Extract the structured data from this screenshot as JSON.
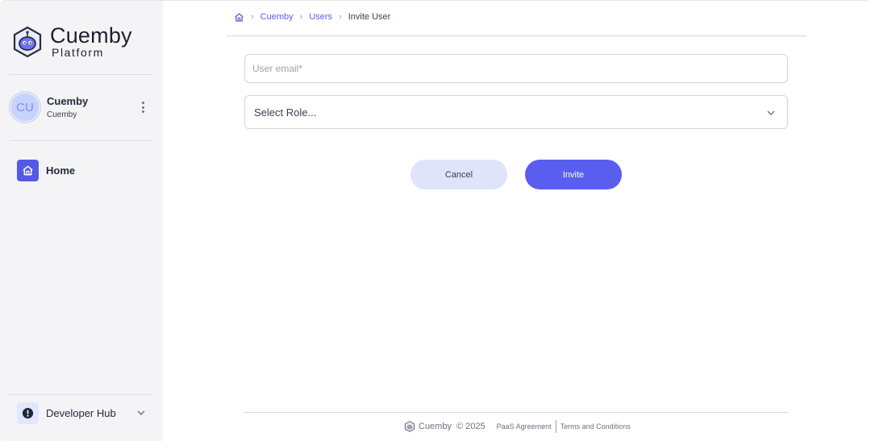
{
  "brand": {
    "title": "Cuemby",
    "subtitle": "Platform"
  },
  "user": {
    "initials": "CU",
    "name": "Cuemby",
    "org": "Cuemby"
  },
  "nav": {
    "home": "Home",
    "developer_hub": "Developer Hub"
  },
  "breadcrumb": {
    "items": [
      "Cuemby",
      "Users"
    ],
    "current": "Invite User"
  },
  "form": {
    "email_placeholder": "User email*",
    "email_value": "",
    "role_select": "Select Role..."
  },
  "buttons": {
    "cancel": "Cancel",
    "invite": "Invite"
  },
  "footer": {
    "brand": "Cuemby",
    "copyright": "© 2025",
    "paas": "PaaS Agreement",
    "terms": "Terms and Conditions"
  },
  "colors": {
    "accent": "#5a5ef0",
    "cancel_bg": "#dfe4fb",
    "sidebar_bg": "#f4f4f7"
  }
}
